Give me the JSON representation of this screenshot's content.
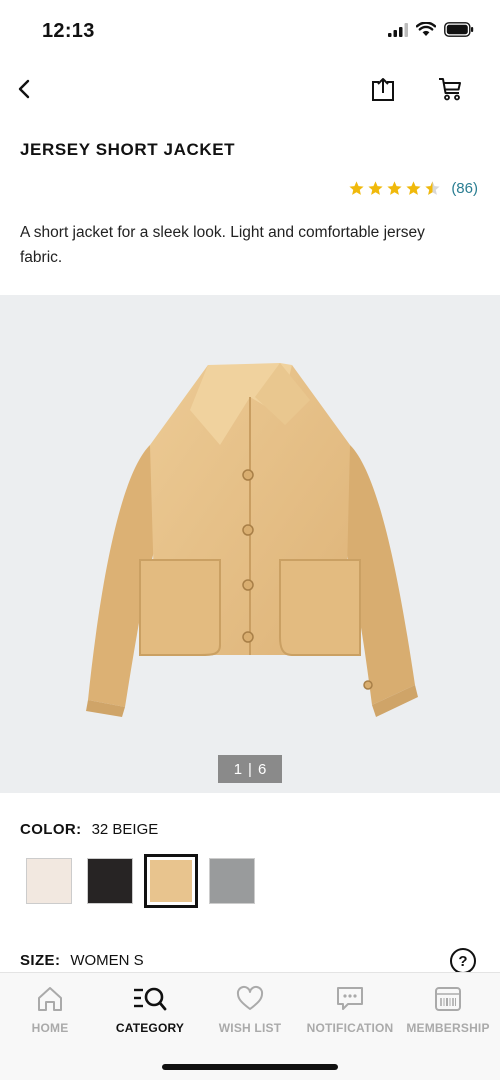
{
  "status": {
    "time": "12:13"
  },
  "product": {
    "title": "JERSEY SHORT JACKET",
    "rating": 4.5,
    "review_count": "(86)",
    "description": "A short jacket for a sleek look. Light and comfortable jersey fabric."
  },
  "gallery": {
    "current": "1",
    "separator": "|",
    "total": "6"
  },
  "color": {
    "label": "COLOR:",
    "value": "32 BEIGE",
    "swatches": [
      {
        "name": "off-white",
        "color": "#f2e8e0"
      },
      {
        "name": "black",
        "color": "#272424"
      },
      {
        "name": "beige",
        "color": "#e8c48e"
      },
      {
        "name": "gray",
        "color": "#999b9c"
      }
    ]
  },
  "size": {
    "label": "SIZE:",
    "value": "WOMEN S",
    "help": "?"
  },
  "tabs": [
    {
      "label": "HOME",
      "icon": "home-icon"
    },
    {
      "label": "CATEGORY",
      "icon": "category-search-icon"
    },
    {
      "label": "WISH LIST",
      "icon": "heart-icon"
    },
    {
      "label": "NOTIFICATION",
      "icon": "chat-icon"
    },
    {
      "label": "MEMBERSHIP",
      "icon": "barcode-card-icon"
    }
  ],
  "colors": {
    "star": "#f0b90b",
    "review": "#2a7e92",
    "gallery_bg": "#eceef0"
  }
}
